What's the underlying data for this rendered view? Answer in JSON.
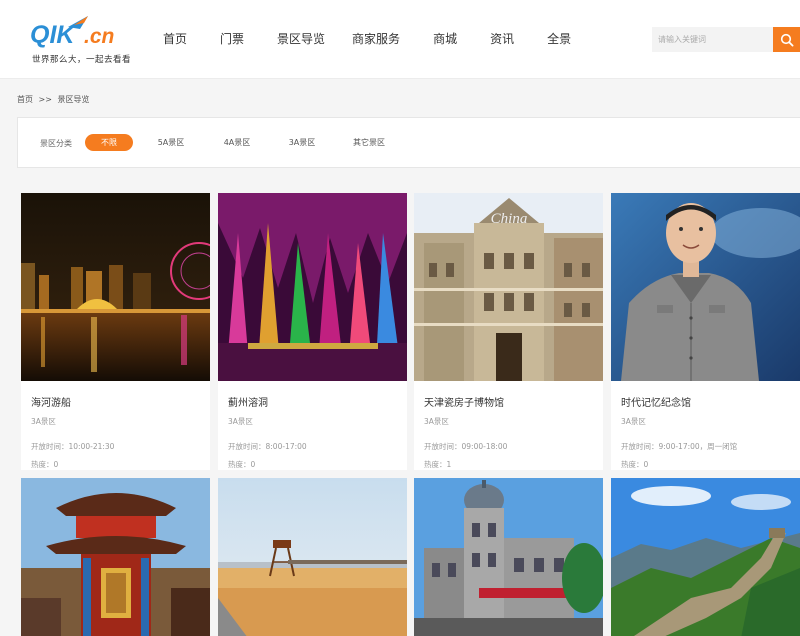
{
  "header": {
    "logo_text": "QIK.cn",
    "slogan": "世界那么大，一起去看看",
    "nav": [
      "首页",
      "门票",
      "景区导览",
      "商家服务",
      "商城",
      "资讯",
      "全景"
    ],
    "search_placeholder": "请输入关键词",
    "accent_color": "#f57c1f"
  },
  "breadcrumb": {
    "home": "首页",
    "separator": ">>",
    "current": "景区导览"
  },
  "filter": {
    "label": "景区分类",
    "options": [
      "不限",
      "5A景区",
      "4A景区",
      "3A景区",
      "其它景区"
    ],
    "selected": "不限"
  },
  "cards": [
    {
      "name": "海河游船",
      "level": "3A景区",
      "hours": "开放时间：10:00-21:30",
      "heat": "热度：0",
      "image": "night-river-city-skyline"
    },
    {
      "name": "蓟州溶洞",
      "level": "3A景区",
      "hours": "开放时间：8:00-17:00",
      "heat": "热度：0",
      "image": "colorful-karst-cave"
    },
    {
      "name": "天津瓷房子博物馆",
      "level": "3A景区",
      "hours": "开放时间：09:00-18:00",
      "heat": "热度：1",
      "image": "porcelain-house-facade"
    },
    {
      "name": "时代记忆纪念馆",
      "level": "3A景区",
      "hours": "开放时间：9:00-17:00，周一闭馆",
      "heat": "热度：0",
      "image": "wax-figure-in-grey-suit"
    },
    {
      "name": "",
      "level": "",
      "hours": "",
      "heat": "",
      "image": "chinese-temple"
    },
    {
      "name": "",
      "level": "",
      "hours": "",
      "heat": "",
      "image": "beach-lifeguard-tower"
    },
    {
      "name": "",
      "level": "",
      "hours": "",
      "heat": "",
      "image": "european-dome-building"
    },
    {
      "name": "",
      "level": "",
      "hours": "",
      "heat": "",
      "image": "great-wall-mountains"
    }
  ]
}
